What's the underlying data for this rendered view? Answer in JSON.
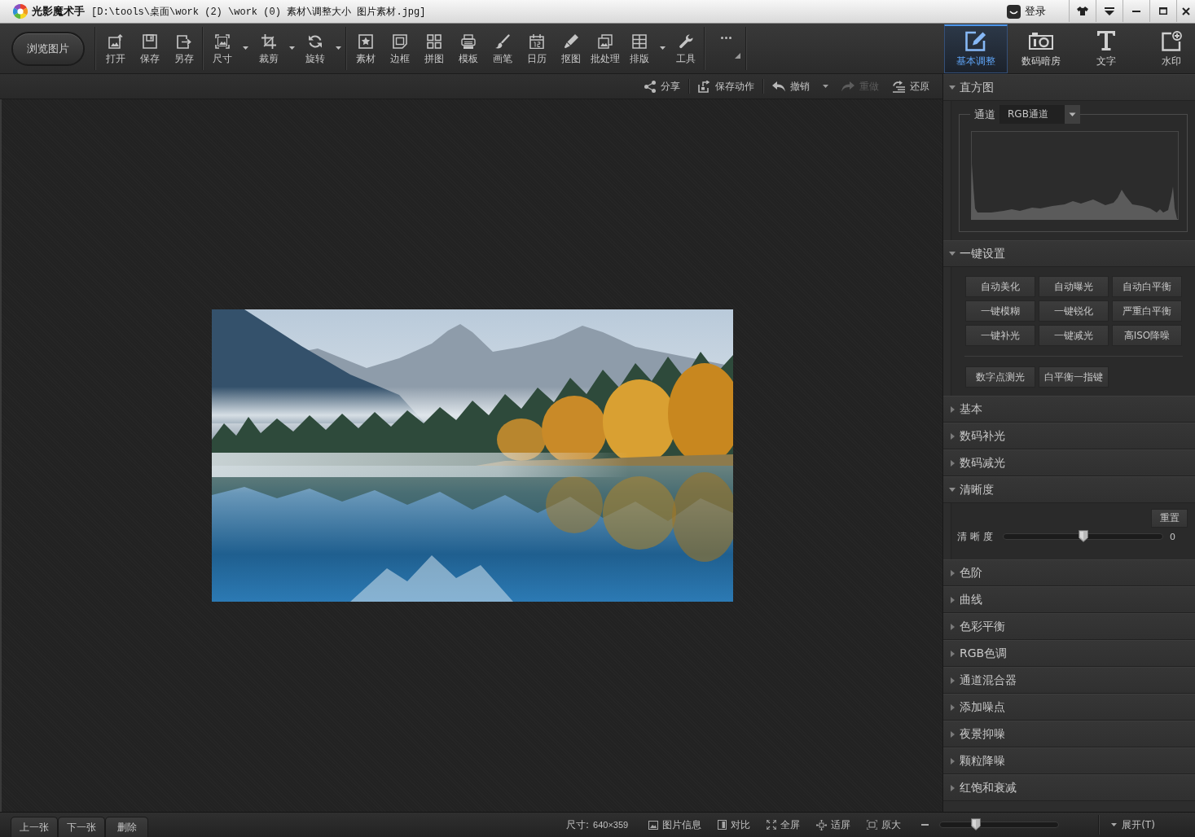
{
  "window": {
    "app_name": "光影魔术手",
    "path": "[D:\\tools\\桌面\\work (2) \\work (0) 素材\\调整大小 图片素材.jpg]",
    "login": "登录"
  },
  "toolbar": {
    "browse_button": "浏览图片",
    "groups": [
      [
        {
          "label": "打开",
          "has_menu": false
        },
        {
          "label": "保存",
          "has_menu": false
        },
        {
          "label": "另存",
          "has_menu": false
        }
      ],
      [
        {
          "label": "尺寸",
          "has_menu": true
        },
        {
          "label": "裁剪",
          "has_menu": true
        },
        {
          "label": "旋转",
          "has_menu": true
        }
      ],
      [
        {
          "label": "素材",
          "has_menu": false
        },
        {
          "label": "边框",
          "has_menu": false
        },
        {
          "label": "拼图",
          "has_menu": false
        },
        {
          "label": "模板",
          "has_menu": false
        },
        {
          "label": "画笔",
          "has_menu": false
        },
        {
          "label": "日历",
          "has_menu": false
        },
        {
          "label": "抠图",
          "has_menu": false
        },
        {
          "label": "批处理",
          "has_menu": false
        },
        {
          "label": "排版",
          "has_menu": true
        },
        {
          "label": "工具",
          "has_menu": false
        }
      ]
    ]
  },
  "mode_tabs": [
    {
      "label": "基本调整",
      "selected": true
    },
    {
      "label": "数码暗房",
      "selected": false
    },
    {
      "label": "文字",
      "selected": false
    },
    {
      "label": "水印",
      "selected": false
    }
  ],
  "action_bar": {
    "groups": [
      [
        {
          "label": "分享",
          "disabled": false,
          "has_menu": false
        }
      ],
      [
        {
          "label": "保存动作",
          "disabled": false,
          "has_menu": false
        }
      ],
      [
        {
          "label": "撤销",
          "disabled": false,
          "has_menu": true
        },
        {
          "label": "重做",
          "disabled": true,
          "has_menu": false
        },
        {
          "label": "还原",
          "disabled": false,
          "has_menu": false
        }
      ]
    ]
  },
  "panel": {
    "sections": [
      {
        "title": "直方图",
        "expanded": true,
        "kind": "histogram",
        "channel_label": "通道",
        "channel": "RGB通道"
      },
      {
        "title": "一键设置",
        "expanded": true,
        "kind": "presets",
        "buttons": [
          "自动美化",
          "自动曝光",
          "自动白平衡",
          "一键模糊",
          "一键锐化",
          "严重白平衡",
          "一键补光",
          "一键减光",
          "高ISO降噪"
        ],
        "extra_buttons": [
          "数字点测光",
          "白平衡一指键"
        ]
      },
      {
        "title": "基本",
        "expanded": false
      },
      {
        "title": "数码补光",
        "expanded": false
      },
      {
        "title": "数码减光",
        "expanded": false
      },
      {
        "title": "清晰度",
        "expanded": true,
        "kind": "slider",
        "reset": "重置",
        "slider_label": "清 晰 度",
        "level": 0.5,
        "reading": "0"
      },
      {
        "title": "色阶",
        "expanded": false
      },
      {
        "title": "曲线",
        "expanded": false
      },
      {
        "title": "色彩平衡",
        "expanded": false
      },
      {
        "title": "RGB色调",
        "expanded": false
      },
      {
        "title": "通道混合器",
        "expanded": false
      },
      {
        "title": "添加噪点",
        "expanded": false
      },
      {
        "title": "夜景抑噪",
        "expanded": false
      },
      {
        "title": "颗粒降噪",
        "expanded": false
      },
      {
        "title": "红饱和衰减",
        "expanded": false
      }
    ]
  },
  "status_bar": {
    "nav_buttons": [
      "上一张",
      "下一张",
      "删除"
    ],
    "size_label": "尺寸:",
    "size_value": "640×359",
    "view_buttons": [
      "图片信息",
      "对比",
      "全屏",
      "适屏",
      "原大"
    ],
    "zoom": {
      "level": 0.3
    },
    "expand_button": "展开(T)"
  }
}
